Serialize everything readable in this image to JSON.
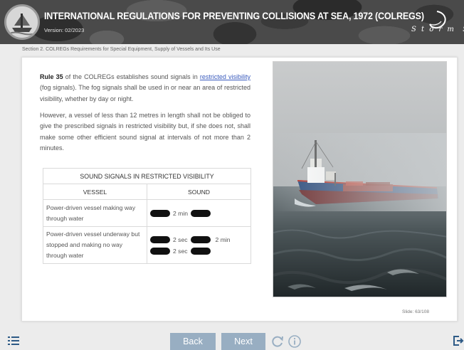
{
  "header": {
    "title": "INTERNATIONAL REGULATIONS FOR PREVENTING COLLISIONS AT SEA, 1972 (COLREGS)",
    "version": "Version: 02/2023",
    "brand": "Storm Sim",
    "emblem_icon": "ship-emblem-icon",
    "logo_icon": "storm-sim-logo-icon"
  },
  "breadcrumb": "Section 2. COLREGs Requirements for Special Equipment, Supply of Vessels and Its Use",
  "content": {
    "p1_rule": "Rule 35",
    "p1_a": " of the COLREGs establishes sound signals in ",
    "p1_link": "restricted visibility",
    "p1_b": " (fog signals). The fog signals shall be used in or near an area of restricted visibility, whether by day or night.",
    "p2": "However, a vessel of less than 12 metres in length shall not be obliged to give the prescribed signals in restricted visibility but, if she does not, shall make some other efficient sound signal at intervals of not more than 2 minutes."
  },
  "table": {
    "caption": "SOUND SIGNALS IN RESTRICTED VISIBILITY",
    "col_vessel": "VESSEL",
    "col_sound": "SOUND",
    "rows": [
      {
        "vessel": "Power-driven vessel making way through water",
        "sound_1": "2 min"
      },
      {
        "vessel": "Power-driven vessel underway but stopped and making no way through water",
        "sound_1": "2 sec",
        "sound_2": "2 min",
        "sound_3": "2 sec"
      }
    ]
  },
  "slide": "Slide: 63/108",
  "nav": {
    "back": "Back",
    "next": "Next",
    "menu_icon": "menu-list-icon",
    "reload_icon": "reload-icon",
    "info_icon": "info-icon",
    "exit_icon": "exit-icon"
  },
  "colors": {
    "button": "#98aec2",
    "link": "#3a5bbd",
    "hull": "#2f4f7f",
    "hull_stripe": "#c0392b"
  }
}
